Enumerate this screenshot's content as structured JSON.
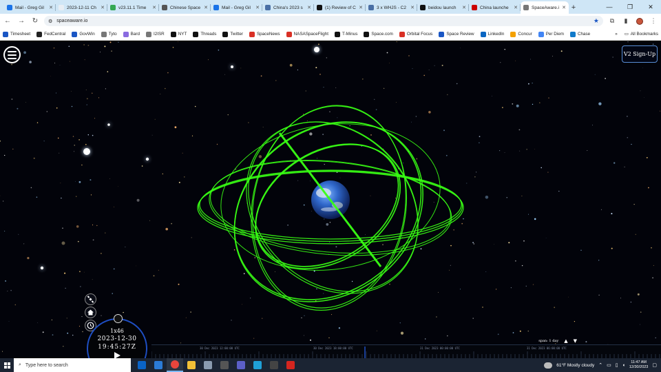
{
  "tabs": [
    {
      "title": "Mail - Greg Gil",
      "color": "#1a73e8"
    },
    {
      "title": "2023-12-11 Ch",
      "color": "#e8eef4"
    },
    {
      "title": "v23.11.1 Time",
      "color": "#34a853"
    },
    {
      "title": "Chinese Space",
      "color": "#555555"
    },
    {
      "title": "Mail - Greg Gil",
      "color": "#1a73e8"
    },
    {
      "title": "China's 2023 s",
      "color": "#4a6fa5"
    },
    {
      "title": "(1) Review of C",
      "color": "#111111"
    },
    {
      "title": "3 x WHJS - C2",
      "color": "#4a6fa5"
    },
    {
      "title": "beidou launch",
      "color": "#111111"
    },
    {
      "title": "China launche",
      "color": "#cc0000"
    },
    {
      "title": "SpaceAware.io",
      "color": "#777777",
      "active": true
    }
  ],
  "window_controls": {
    "minimize": "—",
    "restore": "❐",
    "close": "✕"
  },
  "toolbar": {
    "back": "←",
    "forward": "→",
    "reload": "↻",
    "url": "spaceaware.io",
    "site_info": "⚙"
  },
  "bookmarks": [
    {
      "label": "Timesheet",
      "color": "#1a56c4"
    },
    {
      "label": "FedCentral",
      "color": "#222222"
    },
    {
      "label": "GovWin",
      "color": "#1a56c4"
    },
    {
      "label": "Tyto",
      "color": "#777777"
    },
    {
      "label": "Bard",
      "color": "#8a6be0"
    },
    {
      "label": "I2ISR",
      "color": "#777777"
    },
    {
      "label": "NYT",
      "color": "#111111"
    },
    {
      "label": "Threads",
      "color": "#111111"
    },
    {
      "label": "Twitter",
      "color": "#111111"
    },
    {
      "label": "SpaceNews",
      "color": "#d93025"
    },
    {
      "label": "NASASpaceFlight",
      "color": "#d93025"
    },
    {
      "label": "T-Minus",
      "color": "#111111"
    },
    {
      "label": "Space.com",
      "color": "#111111"
    },
    {
      "label": "Orbital Focus",
      "color": "#d93025"
    },
    {
      "label": "Space Review",
      "color": "#1a56c4"
    },
    {
      "label": "LinkedIn",
      "color": "#0a66c2"
    },
    {
      "label": "Concur",
      "color": "#f4a100"
    },
    {
      "label": "Per Diem",
      "color": "#4285f4"
    },
    {
      "label": "Chase",
      "color": "#117aca"
    }
  ],
  "bookmarks_more": "»",
  "all_bookmarks": "All Bookmarks",
  "viewer": {
    "signup_label": "V2 Sign-Up",
    "clock": {
      "rate": "1x46",
      "date": "2023-12-30",
      "time": "19:45:27Z"
    },
    "span": {
      "label": "span: 1 day",
      "up": "▲",
      "down": "▼"
    },
    "timeline_labels": [
      "30 Dec 2023 12:00:00 UTC",
      "30 Dec 2023 18:00:00 UTC",
      "31 Dec 2023 00:00:00 UTC",
      "31 Dec 2023 06:00:00 UTC"
    ],
    "orbit_color": "#39ff14",
    "accent_color": "#1e4ec2"
  },
  "taskbar": {
    "search_placeholder": "Type here to search",
    "apps": [
      {
        "name": "outlook",
        "color": "#0a64c8"
      },
      {
        "name": "skype",
        "color": "#2b7bd6"
      },
      {
        "name": "chrome",
        "color": "#e8453c",
        "active": true
      },
      {
        "name": "file-explorer",
        "color": "#f2c037"
      },
      {
        "name": "app-gray",
        "color": "#8a9bb0"
      },
      {
        "name": "calculator",
        "color": "#555555"
      },
      {
        "name": "teams",
        "color": "#5b5fc7"
      },
      {
        "name": "edge",
        "color": "#1fa0d8"
      },
      {
        "name": "app-store",
        "color": "#444444"
      },
      {
        "name": "acrobat",
        "color": "#d4251f"
      }
    ],
    "weather": "61°F  Mostly cloudy",
    "time": "11:47 AM",
    "date": "12/30/2023"
  }
}
